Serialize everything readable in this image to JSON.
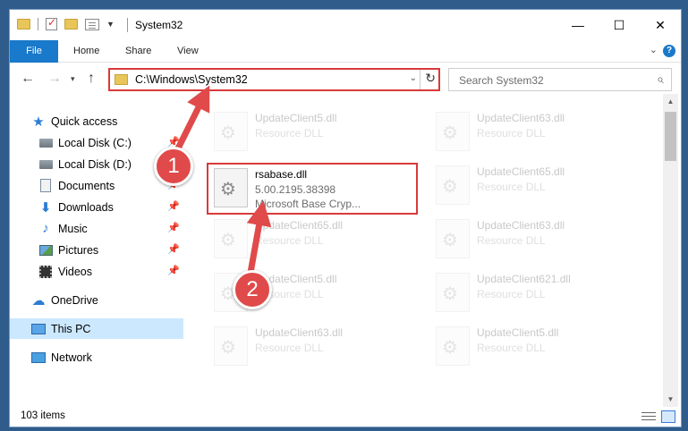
{
  "window": {
    "title": "System32",
    "controls": {
      "minimize": "—",
      "maximize": "☐",
      "close": "✕"
    }
  },
  "ribbon": {
    "tabs": [
      "File",
      "Home",
      "Share",
      "View"
    ],
    "help": "?"
  },
  "nav": {
    "address": "C:\\Windows\\System32",
    "search_placeholder": "Search System32"
  },
  "sidebar": {
    "items": [
      {
        "label": "Quick access",
        "icon": "star-icon",
        "pinned": false
      },
      {
        "label": "Local Disk (C:)",
        "icon": "disk-icon",
        "pinned": true
      },
      {
        "label": "Local Disk (D:)",
        "icon": "disk-icon",
        "pinned": false
      },
      {
        "label": "Documents",
        "icon": "documents-icon",
        "pinned": true
      },
      {
        "label": "Downloads",
        "icon": "downloads-icon",
        "pinned": true
      },
      {
        "label": "Music",
        "icon": "music-icon",
        "pinned": true
      },
      {
        "label": "Pictures",
        "icon": "pictures-icon",
        "pinned": true
      },
      {
        "label": "Videos",
        "icon": "videos-icon",
        "pinned": true
      },
      {
        "label": "OneDrive",
        "icon": "onedrive-icon",
        "pinned": false
      },
      {
        "label": "This PC",
        "icon": "this-pc-icon",
        "pinned": false,
        "selected": true
      },
      {
        "label": "Network",
        "icon": "network-icon",
        "pinned": false
      }
    ]
  },
  "files": {
    "left": [
      {
        "name": "UpdateClient5.dll",
        "type": "Resource DLL"
      },
      {
        "name": "rsabase.dll",
        "version": "5.00.2195.38398",
        "description": "Microsoft Base Cryp...",
        "highlighted": true
      },
      {
        "name": "UpdateClient65.dll",
        "type": "Resource DLL"
      },
      {
        "name": "UpdateClient5.dll",
        "type": "Resource DLL"
      },
      {
        "name": "UpdateClient63.dll",
        "type": "Resource DLL"
      }
    ],
    "right": [
      {
        "name": "UpdateClient63.dll",
        "type": "Resource DLL"
      },
      {
        "name": "UpdateClient65.dll",
        "type": "Resource DLL"
      },
      {
        "name": "UpdateClient63.dll",
        "type": "Resource DLL"
      },
      {
        "name": "UpdateClient621.dll",
        "type": "Resource DLL"
      },
      {
        "name": "UpdateClient5.dll",
        "type": "Resource DLL"
      }
    ]
  },
  "status": {
    "item_count": "103 items"
  },
  "annotations": {
    "step1": "1",
    "step2": "2",
    "color": "#e04a4a"
  }
}
